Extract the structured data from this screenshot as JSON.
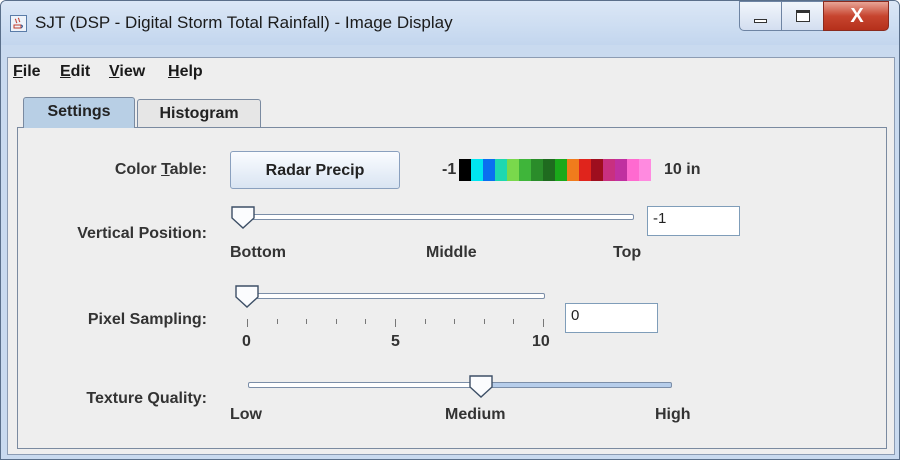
{
  "window": {
    "title": "SJT (DSP - Digital Storm Total Rainfall) - Image Display",
    "close_glyph": "X"
  },
  "menu": [
    {
      "label": "File",
      "mnemonic": "F",
      "rest": "ile"
    },
    {
      "label": "Edit",
      "mnemonic": "E",
      "rest": "dit"
    },
    {
      "label": "View",
      "mnemonic": "V",
      "rest": "iew"
    },
    {
      "label": "Help",
      "mnemonic": "H",
      "rest": "elp"
    }
  ],
  "tabs": [
    {
      "label": "Settings",
      "selected": true
    },
    {
      "label": "Histogram",
      "selected": false
    }
  ],
  "settings": {
    "color_table": {
      "label_pre": "Color ",
      "label_mn": "T",
      "label_post": "able:",
      "button": "Radar Precip",
      "min_label": "-1",
      "max_label": "10 in",
      "colors": [
        "#000000",
        "#00e5f0",
        "#0a6ff0",
        "#1dd8b0",
        "#7ad84c",
        "#3fb53a",
        "#2a8c2a",
        "#1f6b1f",
        "#1aa91a",
        "#f07c1c",
        "#e0241c",
        "#9e0e1e",
        "#c83080",
        "#c030a0",
        "#ff6ad0",
        "#ff8ae0"
      ]
    },
    "vertical_position": {
      "label": "Vertical Position:",
      "value": "-1",
      "slider_fraction": 0.0,
      "ticks": [
        "Bottom",
        "Middle",
        "Top"
      ]
    },
    "pixel_sampling": {
      "label": "Pixel Sampling:",
      "value": "0",
      "slider_value": 0,
      "ticks": [
        "0",
        "5",
        "10"
      ]
    },
    "texture_quality": {
      "label": "Texture Quality:",
      "slider_fraction": 0.55,
      "ticks": [
        "Low",
        "Medium",
        "High"
      ]
    }
  },
  "icons": {
    "app": "java-cup-icon",
    "minimize": "minimize-icon",
    "maximize": "maximize-icon",
    "close": "close-icon",
    "slider_thumb": "slider-thumb-icon"
  },
  "colors": {
    "title_bar": "#c3d6ee",
    "close_button": "#c7452f",
    "selected_tab": "#b8cfe5",
    "panel_bg": "#eeeeee"
  }
}
